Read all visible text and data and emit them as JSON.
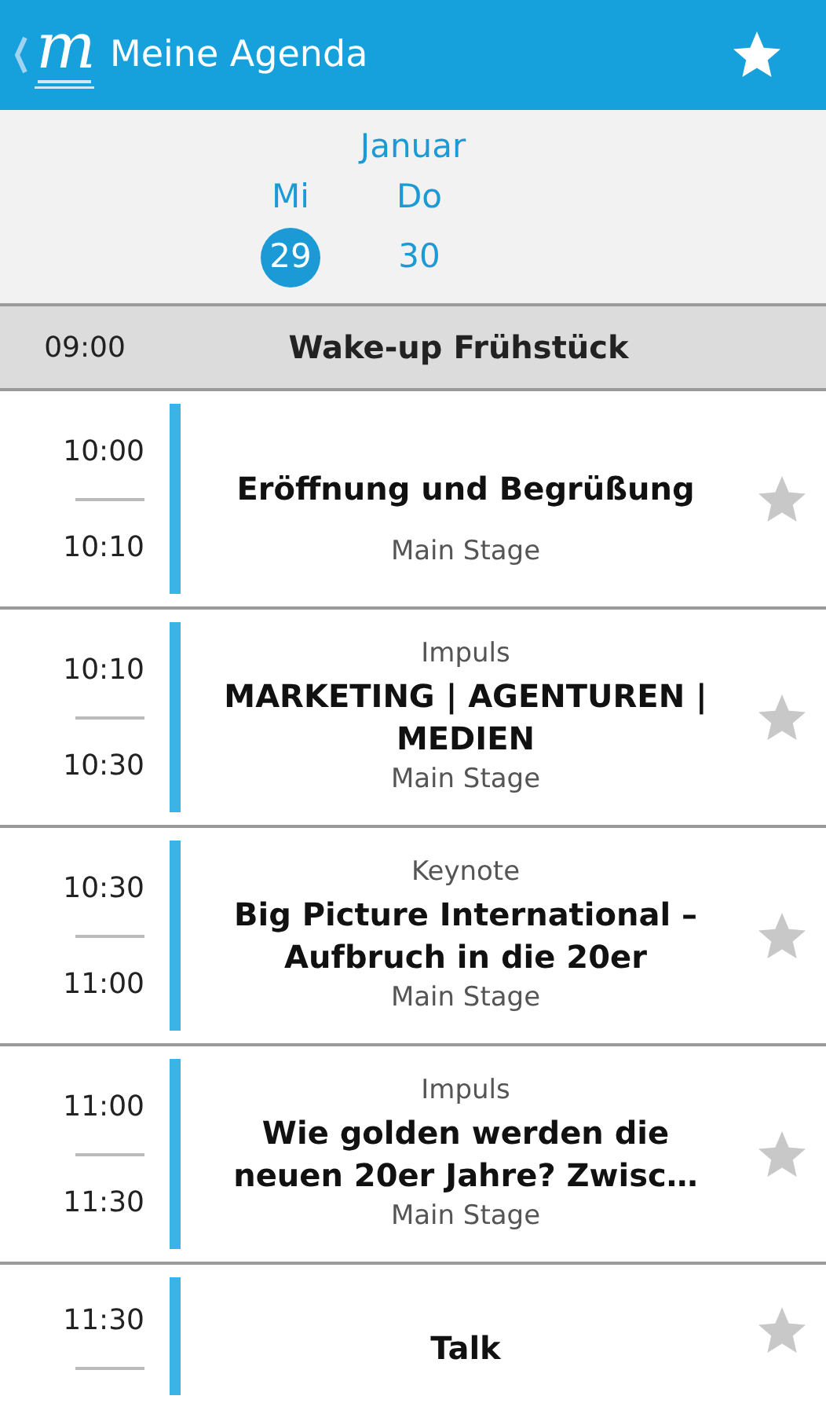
{
  "header": {
    "title": "Meine Agenda",
    "logo_letter": "m"
  },
  "calendar": {
    "month": "Januar",
    "days": [
      {
        "weekday": "Mi",
        "date": "29",
        "selected": true
      },
      {
        "weekday": "Do",
        "date": "30",
        "selected": false
      }
    ]
  },
  "agenda": [
    {
      "kind": "break",
      "start": "09:00",
      "title": "Wake-up Frühstück"
    },
    {
      "kind": "session",
      "start": "10:00",
      "end": "10:10",
      "title": "Eröffnung und Begrüßung",
      "location": "Main Stage",
      "favorite": false
    },
    {
      "kind": "session",
      "start": "10:10",
      "end": "10:30",
      "category": "Impuls",
      "title": "MARKETING | AGENTUREN | MEDIEN",
      "location": "Main Stage",
      "favorite": false
    },
    {
      "kind": "session",
      "start": "10:30",
      "end": "11:00",
      "category": "Keynote",
      "title": "Big Picture International – Aufbruch in die 20er",
      "location": "Main Stage",
      "favorite": false
    },
    {
      "kind": "session",
      "start": "11:00",
      "end": "11:30",
      "category": "Impuls",
      "title": "Wie golden werden die neuen 20er Jahre? Zwisc…",
      "location": "Main Stage",
      "favorite": false
    },
    {
      "kind": "session",
      "start": "11:30",
      "title": "Talk",
      "favorite": false
    }
  ]
}
